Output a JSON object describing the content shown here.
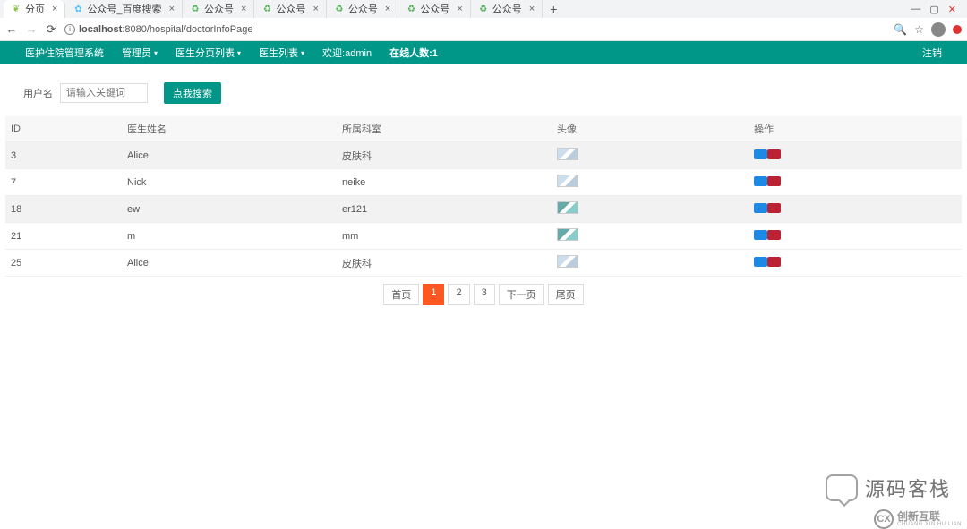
{
  "browser": {
    "tabs": [
      {
        "title": "分页",
        "favicon": "leaf"
      },
      {
        "title": "公众号_百度搜索",
        "favicon": "blue"
      },
      {
        "title": "公众号",
        "favicon": "green"
      },
      {
        "title": "公众号",
        "favicon": "green"
      },
      {
        "title": "公众号",
        "favicon": "green"
      },
      {
        "title": "公众号",
        "favicon": "green"
      },
      {
        "title": "公众号",
        "favicon": "green"
      }
    ],
    "url_host": "localhost",
    "url_port": ":8080",
    "url_path": "/hospital/doctorInfoPage"
  },
  "nav": {
    "brand": "医护住院管理系统",
    "items": [
      "管理员",
      "医生分页列表",
      "医生列表"
    ],
    "welcome": "欢迎:admin",
    "online": "在线人数:1",
    "logout": "注销"
  },
  "search": {
    "label": "用户名",
    "placeholder": "请输入关键词",
    "button": "点我搜索"
  },
  "table": {
    "headers": [
      "ID",
      "医生姓名",
      "所属科室",
      "头像",
      "操作"
    ],
    "rows": [
      {
        "id": "3",
        "name": "Alice",
        "dept": "皮肤科",
        "avatar": "v1"
      },
      {
        "id": "7",
        "name": "Nick",
        "dept": "neike",
        "avatar": "v1"
      },
      {
        "id": "18",
        "name": "ew",
        "dept": "er121",
        "avatar": "v2"
      },
      {
        "id": "21",
        "name": "m",
        "dept": "mm",
        "avatar": "v2"
      },
      {
        "id": "25",
        "name": "Alice",
        "dept": "皮肤科",
        "avatar": "v1"
      }
    ]
  },
  "pagination": {
    "first": "首页",
    "pages": [
      "1",
      "2",
      "3"
    ],
    "active": "1",
    "next": "下一页",
    "last": "尾页"
  },
  "watermark": {
    "text": "源码客栈",
    "logo_main": "创新互联",
    "logo_sub": "CHUANG XIN HU LIAN"
  }
}
